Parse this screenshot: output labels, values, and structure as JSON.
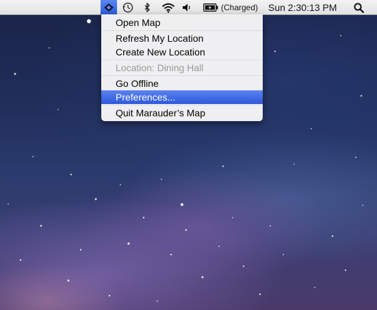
{
  "menubar": {
    "app_icon": "marauders-map-icon",
    "icons": [
      "time-machine-icon",
      "bluetooth-icon",
      "wifi-icon",
      "volume-icon",
      "battery-icon",
      "spotlight-icon"
    ],
    "battery_status": "(Charged)",
    "clock": "Sun 2:30:13 PM"
  },
  "menu": {
    "items": [
      {
        "label": "Open Map"
      },
      {
        "label": "Refresh My Location"
      },
      {
        "label": "Create New Location"
      },
      {
        "label": "Location: Dining Hall"
      },
      {
        "label": "Go Offline"
      },
      {
        "label": "Preferences..."
      },
      {
        "label": "Quit Marauder’s Map"
      }
    ]
  },
  "colors": {
    "highlight": "#2d59dc",
    "menubar": "#e8e8e8",
    "disabled_text": "#9a9a9a"
  }
}
